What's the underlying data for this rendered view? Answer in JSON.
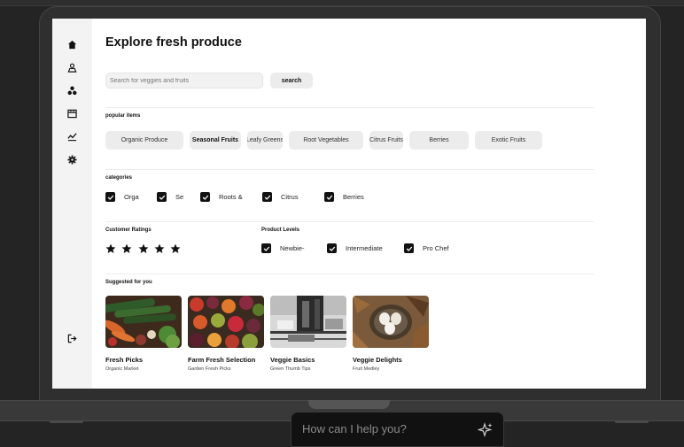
{
  "page": {
    "title": "Explore fresh produce",
    "search": {
      "placeholder": "Search for veggies and fruits",
      "button_label": "search"
    }
  },
  "sidebar": {
    "icons": [
      "home-icon",
      "user-icon",
      "shapes-icon",
      "store-icon",
      "chart-icon",
      "gear-icon",
      "logout-icon"
    ]
  },
  "popular": {
    "label": "popular items",
    "items": [
      {
        "label": "Organic Produce",
        "active": false
      },
      {
        "label": "Seasonal Fruits",
        "active": true
      },
      {
        "label": "Leafy Greens",
        "active": false
      },
      {
        "label": "Root Vegetables",
        "active": false
      },
      {
        "label": "Citrus Fruits",
        "active": false
      },
      {
        "label": "Berries",
        "active": false
      },
      {
        "label": "Exotic Fruits",
        "active": false
      }
    ]
  },
  "categories": {
    "label": "categories",
    "items": [
      {
        "label": "Orga",
        "checked": true
      },
      {
        "label": "Se",
        "checked": true
      },
      {
        "label": "Roots &",
        "checked": true
      },
      {
        "label": "Citrus",
        "checked": true
      },
      {
        "label": "Berries",
        "checked": true
      }
    ]
  },
  "ratings": {
    "label": "Customer Ratings",
    "stars": 5
  },
  "levels": {
    "label": "Product Levels",
    "items": [
      {
        "label": "Newbie-",
        "checked": true
      },
      {
        "label": "Intermediate",
        "checked": true
      },
      {
        "label": "Pro Chef",
        "checked": true
      }
    ]
  },
  "suggested": {
    "label": "Suggested for you",
    "cards": [
      {
        "title": "Fresh Picks",
        "subtitle": "Organic Market"
      },
      {
        "title": "Farm Fresh Selection",
        "subtitle": "Garden Fresh Picks"
      },
      {
        "title": "Veggie Basics",
        "subtitle": "Green Thumb Tips"
      },
      {
        "title": "Veggie Delights",
        "subtitle": "Fruit Medley"
      }
    ]
  },
  "assistant": {
    "placeholder": "How can I help you?"
  },
  "colors": {
    "accent": "#111111",
    "chip_bg": "#ececec",
    "sidebar_bg": "#f3f3f3",
    "desk_bg": "#242424"
  }
}
